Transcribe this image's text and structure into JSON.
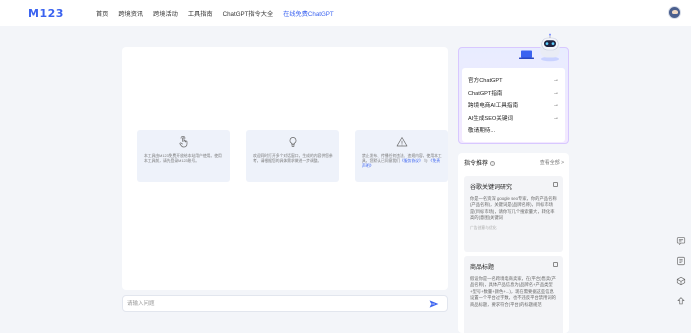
{
  "header": {
    "logo": "M123",
    "nav": [
      "首页",
      "跨境资讯",
      "跨境活动",
      "工具指南",
      "ChatGPT指令大全",
      "在线免费ChatGPT"
    ],
    "active_index": 5
  },
  "cards": [
    {
      "icon": "tap-hand-icon",
      "text": "本工具由M123免费开放给本站用户使用。使用本工具前，请先登录M123账号。",
      "link": ""
    },
    {
      "icon": "lightbulb-icon",
      "text": "欢迎同时打开多个对话窗口，生成的内容供您参考，请根据您的具体需求做进一步调整。",
      "link": ""
    },
    {
      "icon": "warning-icon",
      "text": "禁止发布、传播任何违法、违规内容，使用本工具，您默认已同意我们",
      "link": "《服务协议》",
      "suffix": "与",
      "link2": "《免责声明》"
    }
  ],
  "input": {
    "placeholder": "请输入问题"
  },
  "promo": {
    "items": [
      "官方ChatGPT",
      "ChatGPT指南",
      "跨境电商AI工具指南",
      "AI生成SEO关键词",
      "敬请期待..."
    ]
  },
  "recommend": {
    "title": "指令推荐",
    "more": "查看全部 >",
    "items": [
      {
        "title": "谷歌关键词研究",
        "text": "你是一名资深 google seo专家，你的产品名称(产品名称)，关键词是(品牌名称)，目标市场是(目标市场)，请你写几个搜索量大，转化率高的(意图)关键词",
        "tag": "广告创意与优化"
      },
      {
        "title": "商品标题",
        "text": "假设你是一名跨境电商卖家，在(平台)售卖(产品名称)，具体产品信息为(品牌名+产品类型+型号+数量+颜色+...)，现在需要据这些信息设置一个平台过字数，也不违反平台禁用词的商品标题，要求符合(平台)的标题规范"
      }
    ]
  },
  "colors": {
    "accent": "#3b63f0",
    "background": "#f3f5f9"
  }
}
